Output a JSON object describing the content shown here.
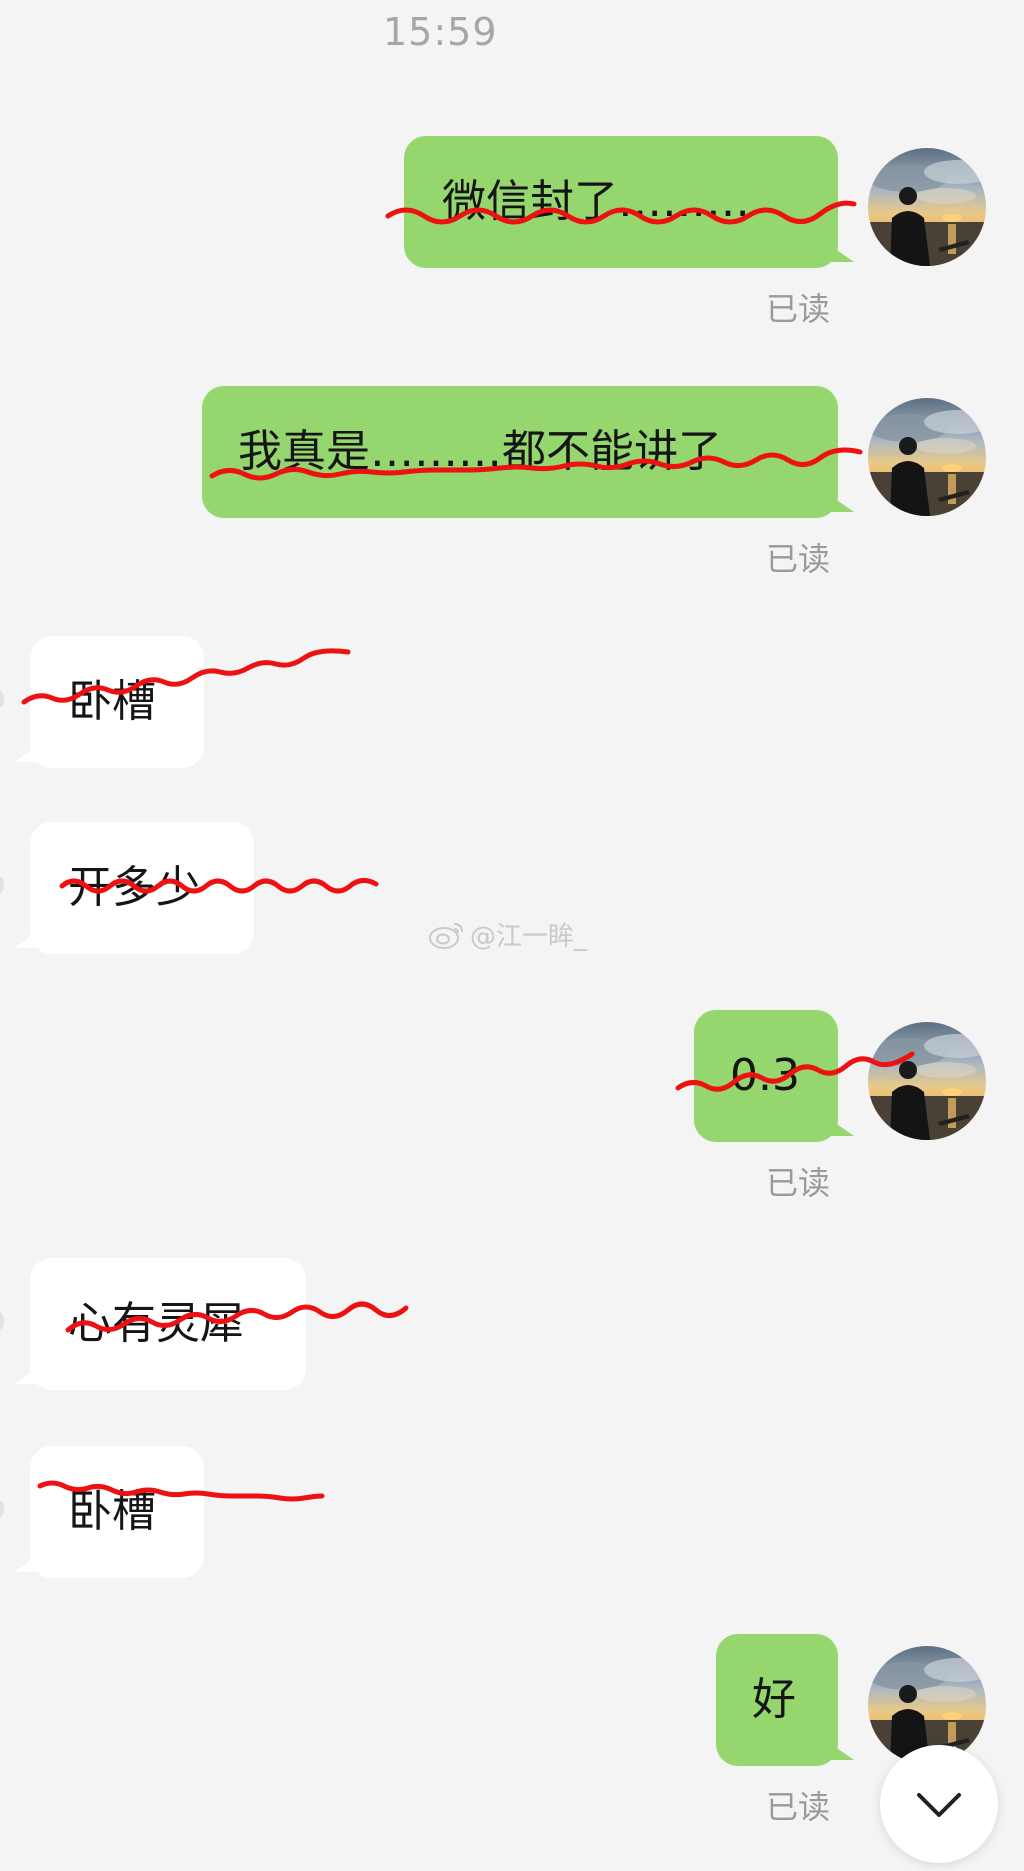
{
  "chat": {
    "timestamp": "15:59",
    "messages": [
      {
        "side": "mine",
        "text": "微信封了………",
        "read": "已读"
      },
      {
        "side": "mine",
        "text": "我真是………都不能讲了",
        "read": "已读"
      },
      {
        "side": "theirs",
        "text": "卧槽"
      },
      {
        "side": "theirs",
        "text": "开多少"
      },
      {
        "side": "mine",
        "text": "0.3",
        "read": "已读"
      },
      {
        "side": "theirs",
        "text": "心有灵犀"
      },
      {
        "side": "theirs",
        "text": "卧槽"
      },
      {
        "side": "mine",
        "text": "好",
        "read": "已读"
      }
    ]
  },
  "watermark": {
    "text": "@江一眸_",
    "icon": "weibo-icon"
  },
  "scroll_button": {
    "icon": "chevron-down-icon"
  },
  "colors": {
    "background": "#f4f4f4",
    "my_bubble": "#95d66e",
    "their_bubble": "#ffffff",
    "scribble": "#ee1111",
    "read_receipt": "#9a9a9a"
  }
}
